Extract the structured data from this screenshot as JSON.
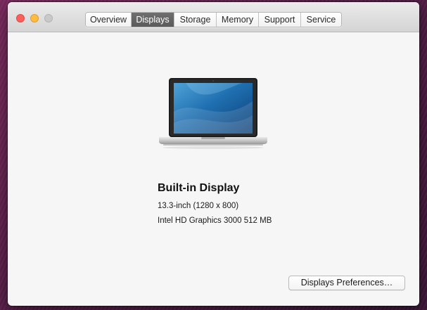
{
  "window": {
    "controls": {
      "close": "close-button",
      "minimize": "minimize-button",
      "zoom": "zoom-button"
    }
  },
  "tabs": [
    {
      "label": "Overview",
      "active": false
    },
    {
      "label": "Displays",
      "active": true
    },
    {
      "label": "Storage",
      "active": false
    },
    {
      "label": "Memory",
      "active": false
    },
    {
      "label": "Support",
      "active": false
    },
    {
      "label": "Service",
      "active": false
    }
  ],
  "display": {
    "icon": "laptop-icon",
    "name": "Built-in Display",
    "size": "13.3-inch (1280 x 800)",
    "graphics": "Intel HD Graphics 3000 512 MB"
  },
  "actions": {
    "preferences_label": "Displays Preferences…"
  },
  "colors": {
    "active_tab": "#5f5f5f",
    "close": "#fc605c",
    "minimize": "#fdbc40",
    "zoom_inactive": "#c9c9c9"
  }
}
